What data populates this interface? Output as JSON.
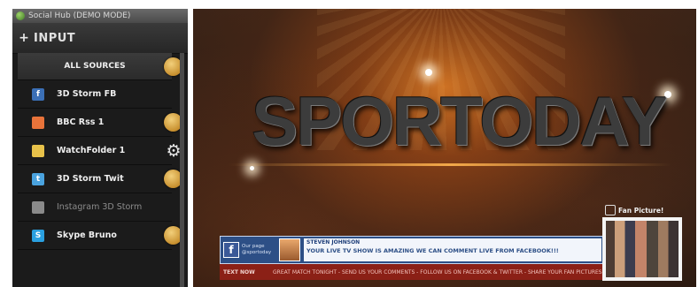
{
  "window": {
    "title": "Social Hub (DEMO MODE)"
  },
  "panel": {
    "header": "INPUT",
    "all_sources": "ALL SOURCES",
    "sources": [
      {
        "label": "3D Storm FB",
        "icon": "facebook-icon",
        "color": "#3b6fb6",
        "glyph": "f",
        "badge": false,
        "gear": false,
        "dim": false
      },
      {
        "label": "BBC Rss 1",
        "icon": "rss-icon",
        "color": "#e8733a",
        "glyph": "",
        "badge": true,
        "gear": false,
        "dim": false
      },
      {
        "label": "WatchFolder 1",
        "icon": "folder-icon",
        "color": "#e8c24a",
        "glyph": "",
        "badge": false,
        "gear": true,
        "dim": false
      },
      {
        "label": "3D Storm Twit",
        "icon": "twitter-icon",
        "color": "#4aa3df",
        "glyph": "t",
        "badge": true,
        "gear": false,
        "dim": false
      },
      {
        "label": "Instagram 3D Storm",
        "icon": "instagram-icon",
        "color": "#8a8a8a",
        "glyph": "",
        "badge": false,
        "gear": false,
        "dim": true
      },
      {
        "label": "Skype Bruno",
        "icon": "skype-icon",
        "color": "#2aa0e0",
        "glyph": "S",
        "badge": true,
        "gear": false,
        "dim": false
      }
    ]
  },
  "preview": {
    "logo": "SPORTODAY",
    "lower_third": {
      "fb_label": "Our page @sportoday",
      "author": "STEVEN JOHNSON",
      "comment": "YOUR LIVE TV SHOW IS AMAZING WE CAN COMMENT LIVE FROM FACEBOOK!!!",
      "text_now_label": "TEXT NOW",
      "ticker": "GREAT MATCH TONIGHT - SEND US YOUR COMMENTS - FOLLOW US ON FACEBOOK & TWITTER - SHARE YOUR FAN PICTURES"
    },
    "fan_pictures_label": "Fan Picture!"
  }
}
